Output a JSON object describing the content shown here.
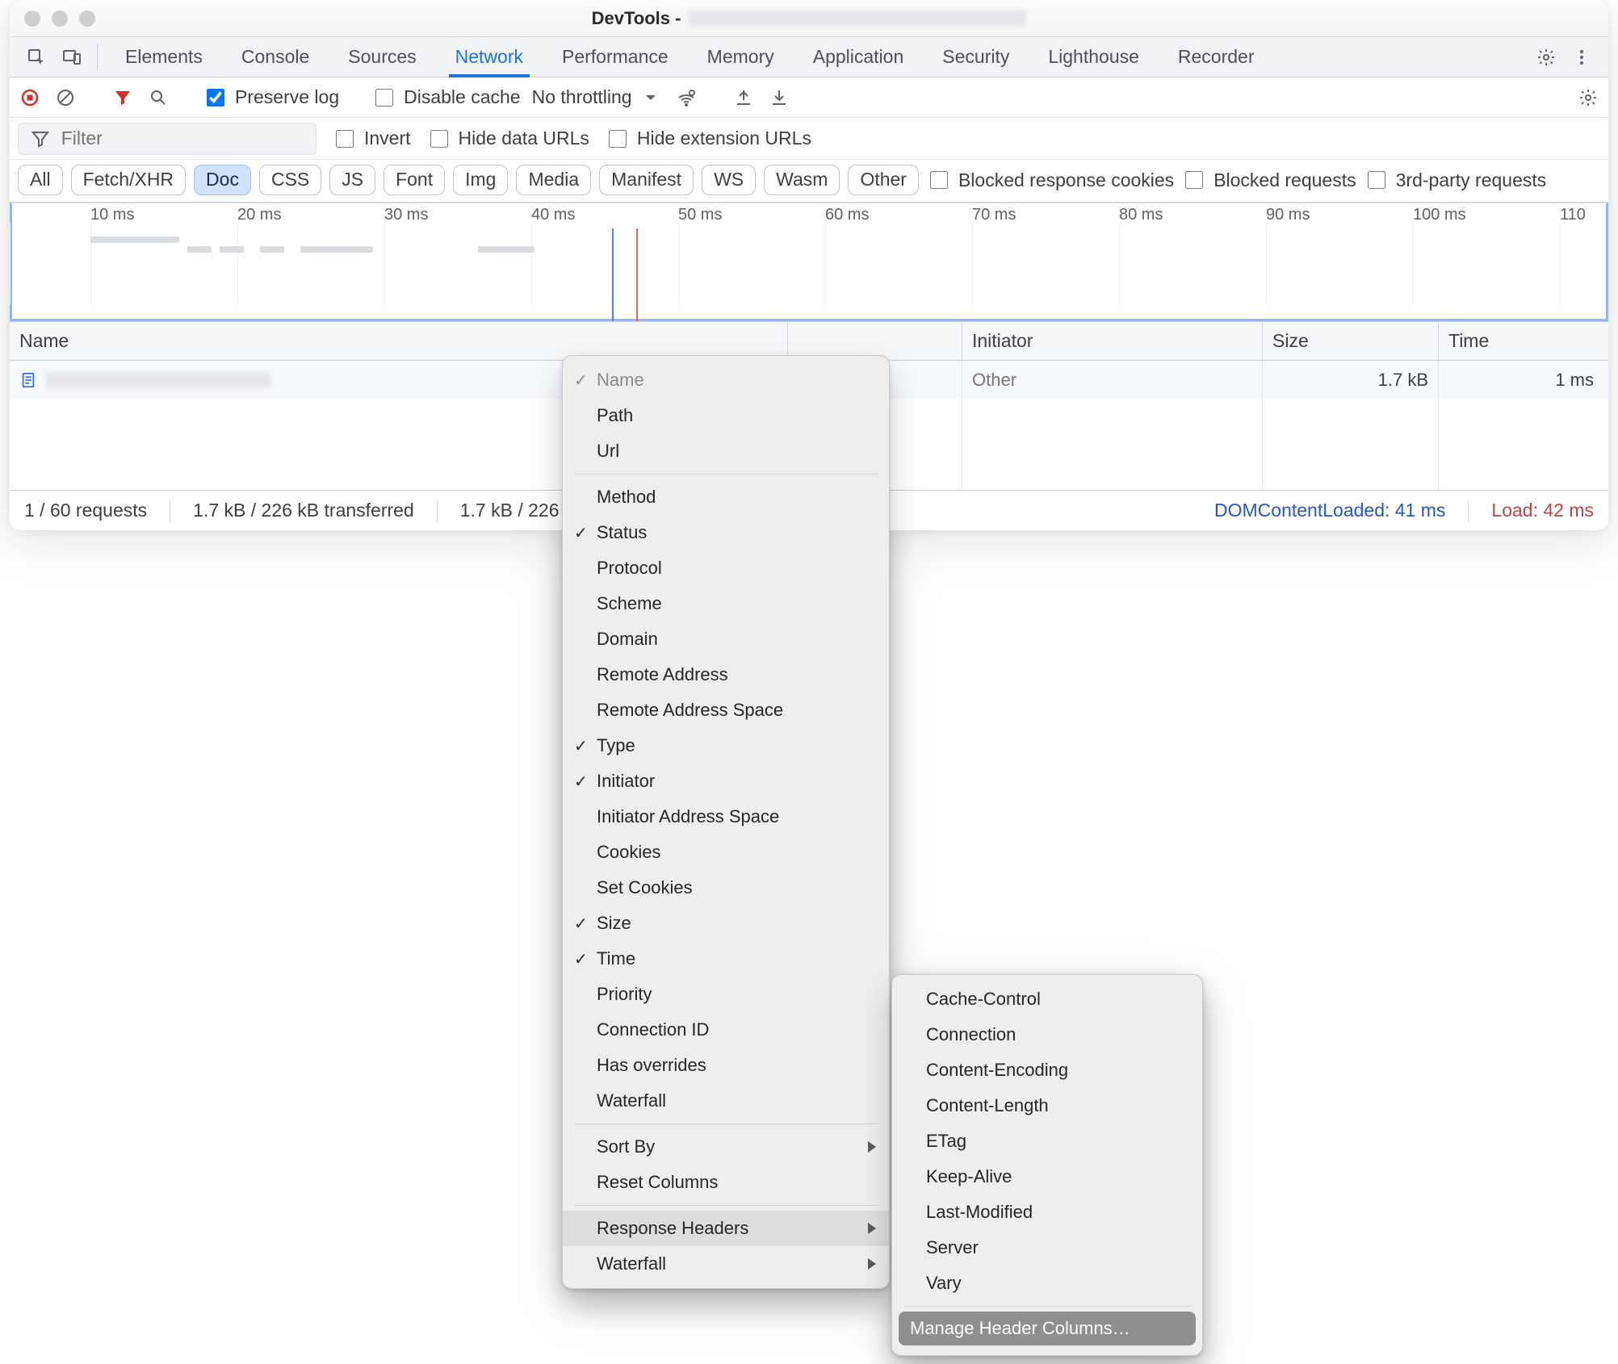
{
  "window": {
    "title_prefix": "DevTools -"
  },
  "main_tabs": {
    "elements": "Elements",
    "console": "Console",
    "sources": "Sources",
    "network": "Network",
    "performance": "Performance",
    "memory": "Memory",
    "application": "Application",
    "security": "Security",
    "lighthouse": "Lighthouse",
    "recorder": "Recorder"
  },
  "toolbar": {
    "preserve_log": "Preserve log",
    "disable_cache": "Disable cache",
    "throttling": "No throttling"
  },
  "filter": {
    "placeholder": "Filter",
    "invert": "Invert",
    "hide_data_urls": "Hide data URLs",
    "hide_ext_urls": "Hide extension URLs"
  },
  "chips": {
    "all": "All",
    "fetch": "Fetch/XHR",
    "doc": "Doc",
    "css": "CSS",
    "js": "JS",
    "font": "Font",
    "img": "Img",
    "media": "Media",
    "manifest": "Manifest",
    "ws": "WS",
    "wasm": "Wasm",
    "other": "Other",
    "blocked_cookies": "Blocked response cookies",
    "blocked_requests": "Blocked requests",
    "third_party": "3rd-party requests"
  },
  "timeline": {
    "ticks": [
      "10 ms",
      "20 ms",
      "30 ms",
      "40 ms",
      "50 ms",
      "60 ms",
      "70 ms",
      "80 ms",
      "90 ms",
      "100 ms",
      "110"
    ]
  },
  "grid": {
    "headers": {
      "name": "Name",
      "initiator": "Initiator",
      "size": "Size",
      "time": "Time"
    },
    "row": {
      "initiator": "Other",
      "size": "1.7 kB",
      "time": "1 ms"
    }
  },
  "status": {
    "requests": "1 / 60 requests",
    "transferred": "1.7 kB / 226 kB transferred",
    "resources": "1.7 kB / 226",
    "dcl": "DOMContentLoaded: 41 ms",
    "load": "Load: 42 ms"
  },
  "context_menu": {
    "name": "Name",
    "path": "Path",
    "url": "Url",
    "method": "Method",
    "status": "Status",
    "protocol": "Protocol",
    "scheme": "Scheme",
    "domain": "Domain",
    "remote_address": "Remote Address",
    "remote_address_space": "Remote Address Space",
    "type": "Type",
    "initiator": "Initiator",
    "initiator_address_space": "Initiator Address Space",
    "cookies": "Cookies",
    "set_cookies": "Set Cookies",
    "size": "Size",
    "time": "Time",
    "priority": "Priority",
    "connection_id": "Connection ID",
    "has_overrides": "Has overrides",
    "waterfall": "Waterfall",
    "sort_by": "Sort By",
    "reset_columns": "Reset Columns",
    "response_headers": "Response Headers",
    "waterfall2": "Waterfall"
  },
  "submenu": {
    "cache_control": "Cache-Control",
    "connection": "Connection",
    "content_encoding": "Content-Encoding",
    "content_length": "Content-Length",
    "etag": "ETag",
    "keep_alive": "Keep-Alive",
    "last_modified": "Last-Modified",
    "server": "Server",
    "vary": "Vary",
    "manage": "Manage Header Columns…"
  }
}
